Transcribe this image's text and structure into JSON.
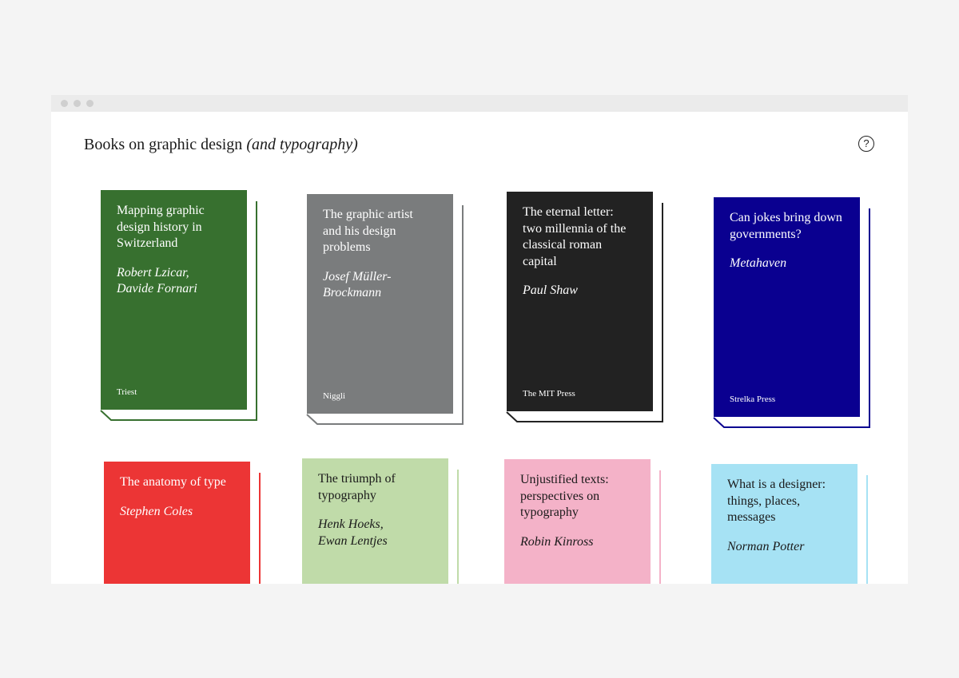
{
  "page": {
    "title": "Books on graphic design",
    "title_italic": "(and typography)",
    "help_icon": "question-circle-icon"
  },
  "books": [
    {
      "title": "Mapping graphic\ndesign history in\nSwitzerland",
      "author": "Robert Lzicar,\nDavide Fornari",
      "publisher": "Triest",
      "color": "#37702f",
      "text_color": "#ffffff"
    },
    {
      "title": "The graphic artist\nand his design\nproblems",
      "author": "Josef Müller-\nBrockmann",
      "publisher": "Niggli",
      "color": "#7a7c7d",
      "text_color": "#ffffff"
    },
    {
      "title": "The eternal letter:\ntwo millennia of the\nclassical roman\ncapital",
      "author": "Paul Shaw",
      "publisher": "The MIT Press",
      "color": "#222222",
      "text_color": "#ffffff"
    },
    {
      "title": "Can jokes bring down\ngovernments?",
      "author": "Metahaven",
      "publisher": "Strelka Press",
      "color": "#0a0090",
      "text_color": "#ffffff"
    },
    {
      "title": "The anatomy of type",
      "author": "Stephen Coles",
      "publisher": "",
      "color": "#ec3535",
      "text_color": "#ffffff"
    },
    {
      "title": "The triumph of\ntypography",
      "author": "Henk Hoeks,\nEwan Lentjes",
      "publisher": "",
      "color": "#c0dba9",
      "text_color": "#1a1a1a"
    },
    {
      "title": "Unjustified texts:\nperspectives on\ntypography",
      "author": "Robin Kinross",
      "publisher": "",
      "color": "#f4b2c8",
      "text_color": "#1a1a1a"
    },
    {
      "title": "What is a designer:\nthings, places,\nmessages",
      "author": "Norman Potter",
      "publisher": "",
      "color": "#a6e2f4",
      "text_color": "#1a1a1a"
    }
  ]
}
